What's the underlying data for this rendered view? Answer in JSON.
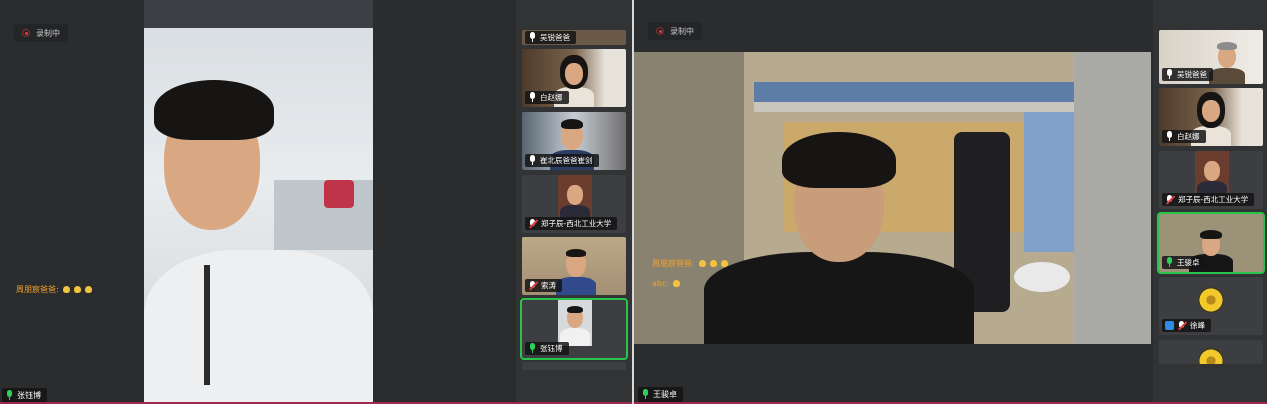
{
  "left_window": {
    "recording_label": "录制中",
    "main_speaker_name": "张钰博",
    "chat_message": "周朋宸爸爸:",
    "participants": [
      {
        "name": "吴锐爸爸",
        "mic": "on"
      },
      {
        "name": "白赵娜",
        "mic": "on"
      },
      {
        "name": "崔北辰爸爸崔剑",
        "mic": "on"
      },
      {
        "name": "郑子辰-西北工业大学",
        "mic": "off"
      },
      {
        "name": "索涛",
        "mic": "off"
      },
      {
        "name": "张钰博",
        "mic": "on",
        "active": true
      }
    ]
  },
  "right_window": {
    "recording_label": "录制中",
    "main_speaker_name": "王骏卓",
    "chat_message_1": "周朋宸爸爸:",
    "chat_message_2": "abc:",
    "participants": [
      {
        "name": "吴锐爸爸",
        "mic": "on"
      },
      {
        "name": "白赵娜",
        "mic": "on"
      },
      {
        "name": "郑子辰-西北工业大学",
        "mic": "off"
      },
      {
        "name": "王骏卓",
        "mic": "on",
        "active": true
      },
      {
        "name": "徐峰",
        "mic": "off",
        "badge": "user"
      }
    ]
  },
  "colors": {
    "active_speaker": "#29c44a",
    "chat_name": "#f0a12c",
    "recording_dot": "#e14040"
  },
  "icons": [
    "record-icon",
    "microphone-icon",
    "microphone-muted-icon",
    "clap-emoji-icon",
    "user-badge-icon",
    "sunflower-avatar-icon"
  ]
}
